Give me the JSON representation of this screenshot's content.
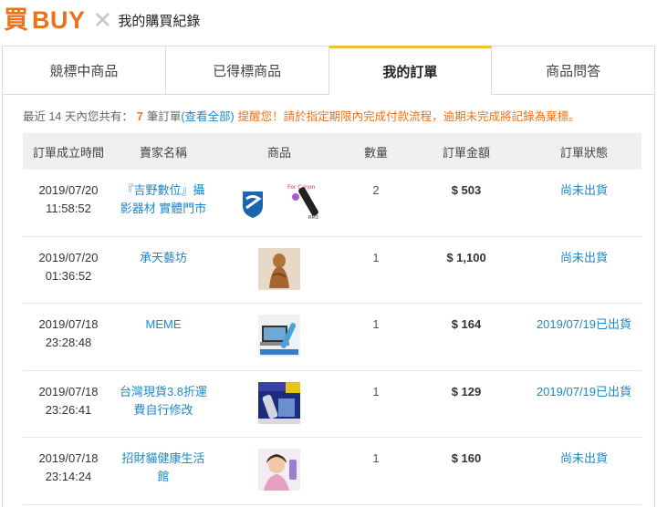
{
  "header": {
    "logo_glyph": "買",
    "logo_text": "BUY",
    "separator": "✕",
    "title": "我的購買紀錄"
  },
  "tabs": [
    {
      "label": "競標中商品",
      "active": false
    },
    {
      "label": "已得標商品",
      "active": false
    },
    {
      "label": "我的訂單",
      "active": true
    },
    {
      "label": "商品問答",
      "active": false
    }
  ],
  "notice": {
    "prefix": "最近 14 天內您共有：",
    "count": "7",
    "suffix": "筆訂單",
    "link": "(查看全部)",
    "warning": "提醒您！請於指定期限內完成付款流程，逾期未完成將記錄為棄標。"
  },
  "table": {
    "headers": [
      "訂單成立時間",
      "賣家名稱",
      "商品",
      "數量",
      "訂單金額",
      "訂單狀態"
    ],
    "rows": [
      {
        "date": "2019/07/20",
        "time": "11:58:52",
        "seller": "『吉野數位』攝影器材 實體門市",
        "qty": "2",
        "amount": "$ 503",
        "status": "尚未出貨",
        "thumbs": [
          "shield-logo-thumbnail",
          "remote-shutter-thumbnail"
        ]
      },
      {
        "date": "2019/07/20",
        "time": "01:36:52",
        "seller": "承天藝坊",
        "qty": "1",
        "amount": "$ 1,100",
        "status": "尚未出貨",
        "thumbs": [
          "wood-carving-thumbnail"
        ]
      },
      {
        "date": "2019/07/18",
        "time": "23:28:48",
        "seller": "MEME",
        "qty": "1",
        "amount": "$ 164",
        "status": "2019/07/19已出貨",
        "thumbs": [
          "laptop-gadget-thumbnail"
        ]
      },
      {
        "date": "2019/07/18",
        "time": "23:26:41",
        "seller": "台灣現貨3.8折運費自行修改",
        "qty": "1",
        "amount": "$ 129",
        "status": "2019/07/19已出貨",
        "thumbs": [
          "blue-device-thumbnail"
        ]
      },
      {
        "date": "2019/07/18",
        "time": "23:14:24",
        "seller": "招財貓健康生活館",
        "qty": "1",
        "amount": "$ 160",
        "status": "尚未出貨",
        "thumbs": [
          "woman-product-thumbnail"
        ]
      }
    ]
  }
}
